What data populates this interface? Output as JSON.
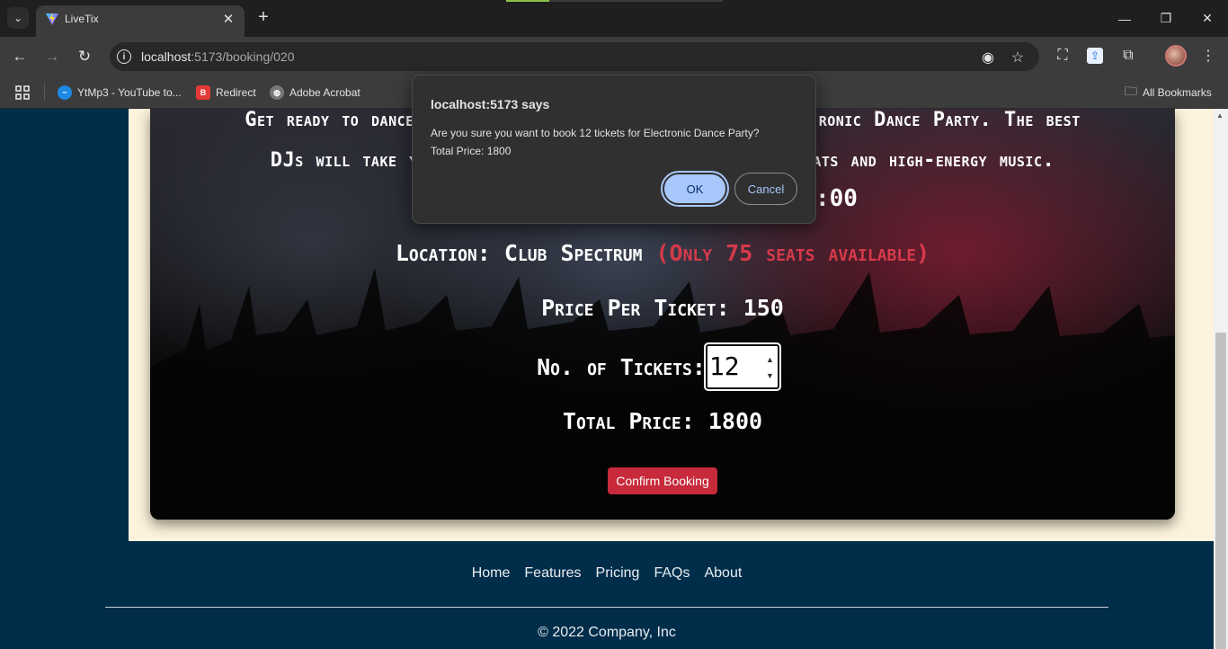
{
  "browser": {
    "tab_title": "LiveTix",
    "url_host": "localhost",
    "url_path": ":5173/booking/020",
    "bookmarks": [
      {
        "label": "YtMp3 - YouTube to...",
        "icon": "ytmp3-icon",
        "color": "#1e88e5"
      },
      {
        "label": "Redirect",
        "icon": "b-icon",
        "color": "#e53935"
      },
      {
        "label": "Adobe Acrobat",
        "icon": "globe-icon",
        "color": "#777777"
      }
    ],
    "all_bookmarks": "All Bookmarks"
  },
  "event": {
    "desc_line1": "Get ready to dance the night away at the Electronic Dance Party. The best",
    "desc_line1_visible_left": "Get ready to dance",
    "desc_line1_visible_right": "ronic Dance Party. The best",
    "desc_line2_visible_left": "DJs will take yo",
    "desc_line2_visible_right": "ats and high-energy music.",
    "time_fragment": ":00",
    "location_label": "Location:",
    "location_value": "Club Spectrum",
    "availability": "(Only 75 seats available)",
    "price_label": "Price Per Ticket:",
    "price_value": "150",
    "tickets_label": "No. of Tickets:",
    "tickets_value": "12",
    "total_label": "Total Price:",
    "total_value": "1800",
    "confirm_label": "Confirm Booking"
  },
  "footer": {
    "links": [
      "Home",
      "Features",
      "Pricing",
      "FAQs",
      "About"
    ],
    "copyright": "© 2022 Company, Inc"
  },
  "dialog": {
    "title": "localhost:5173 says",
    "message_line1": "Are you sure you want to book 12 tickets for Electronic Dance Party?",
    "message_line2": "Total Price: 1800",
    "ok_label": "OK",
    "cancel_label": "Cancel"
  },
  "colors": {
    "page_bg": "#002d49",
    "cream": "#fdf2dc",
    "accent_red": "#c72a3b",
    "availability_red": "#d63a4a",
    "dialog_ok": "#a8c7fa"
  }
}
